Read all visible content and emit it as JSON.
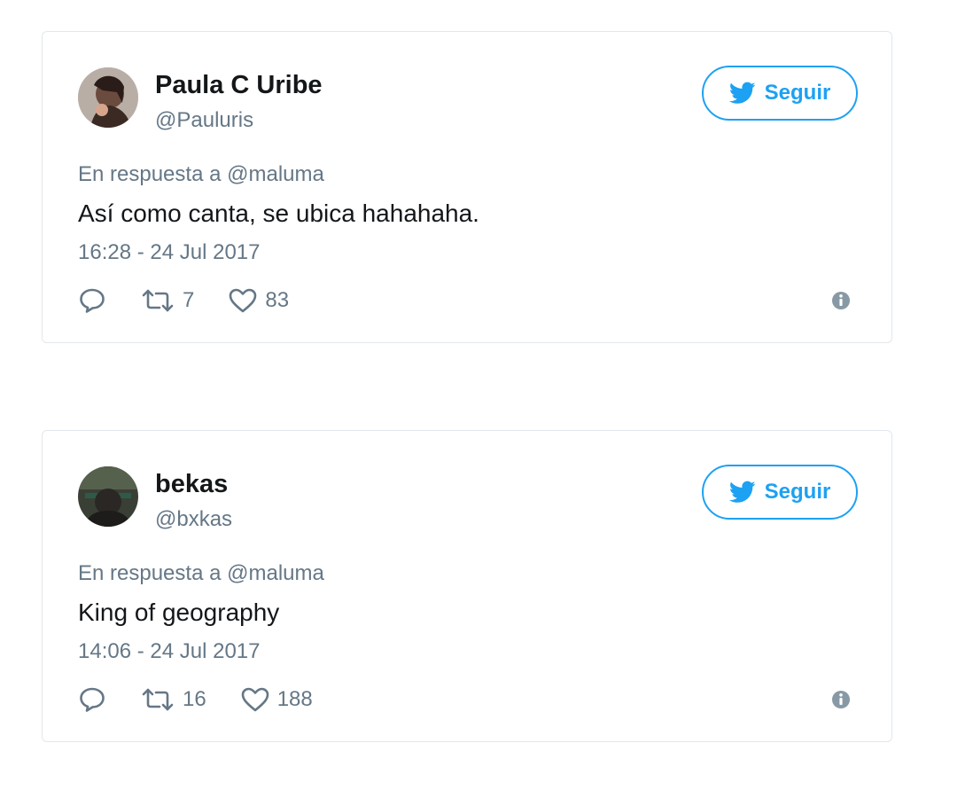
{
  "tweets": [
    {
      "name": "Paula C Uribe",
      "handle": "@Pauluris",
      "follow_label": "Seguir",
      "reply_prefix": "En respuesta a",
      "reply_mention": "@maluma",
      "text": "Así como canta, se ubica hahahaha.",
      "timestamp": "16:28 - 24 Jul 2017",
      "retweets": "7",
      "likes": "83"
    },
    {
      "name": "bekas",
      "handle": "@bxkas",
      "follow_label": "Seguir",
      "reply_prefix": "En respuesta a",
      "reply_mention": "@maluma",
      "text": "King of geography",
      "timestamp": "14:06 - 24 Jul 2017",
      "retweets": "16",
      "likes": "188"
    }
  ],
  "icons": {
    "bird": "twitter-bird-icon",
    "reply": "reply-icon",
    "retweet": "retweet-icon",
    "like": "heart-icon",
    "info": "info-icon"
  },
  "colors": {
    "accent": "#1da1f2",
    "secondary_text": "#657786",
    "primary_text": "#14171a",
    "border": "#e1e8ed"
  }
}
